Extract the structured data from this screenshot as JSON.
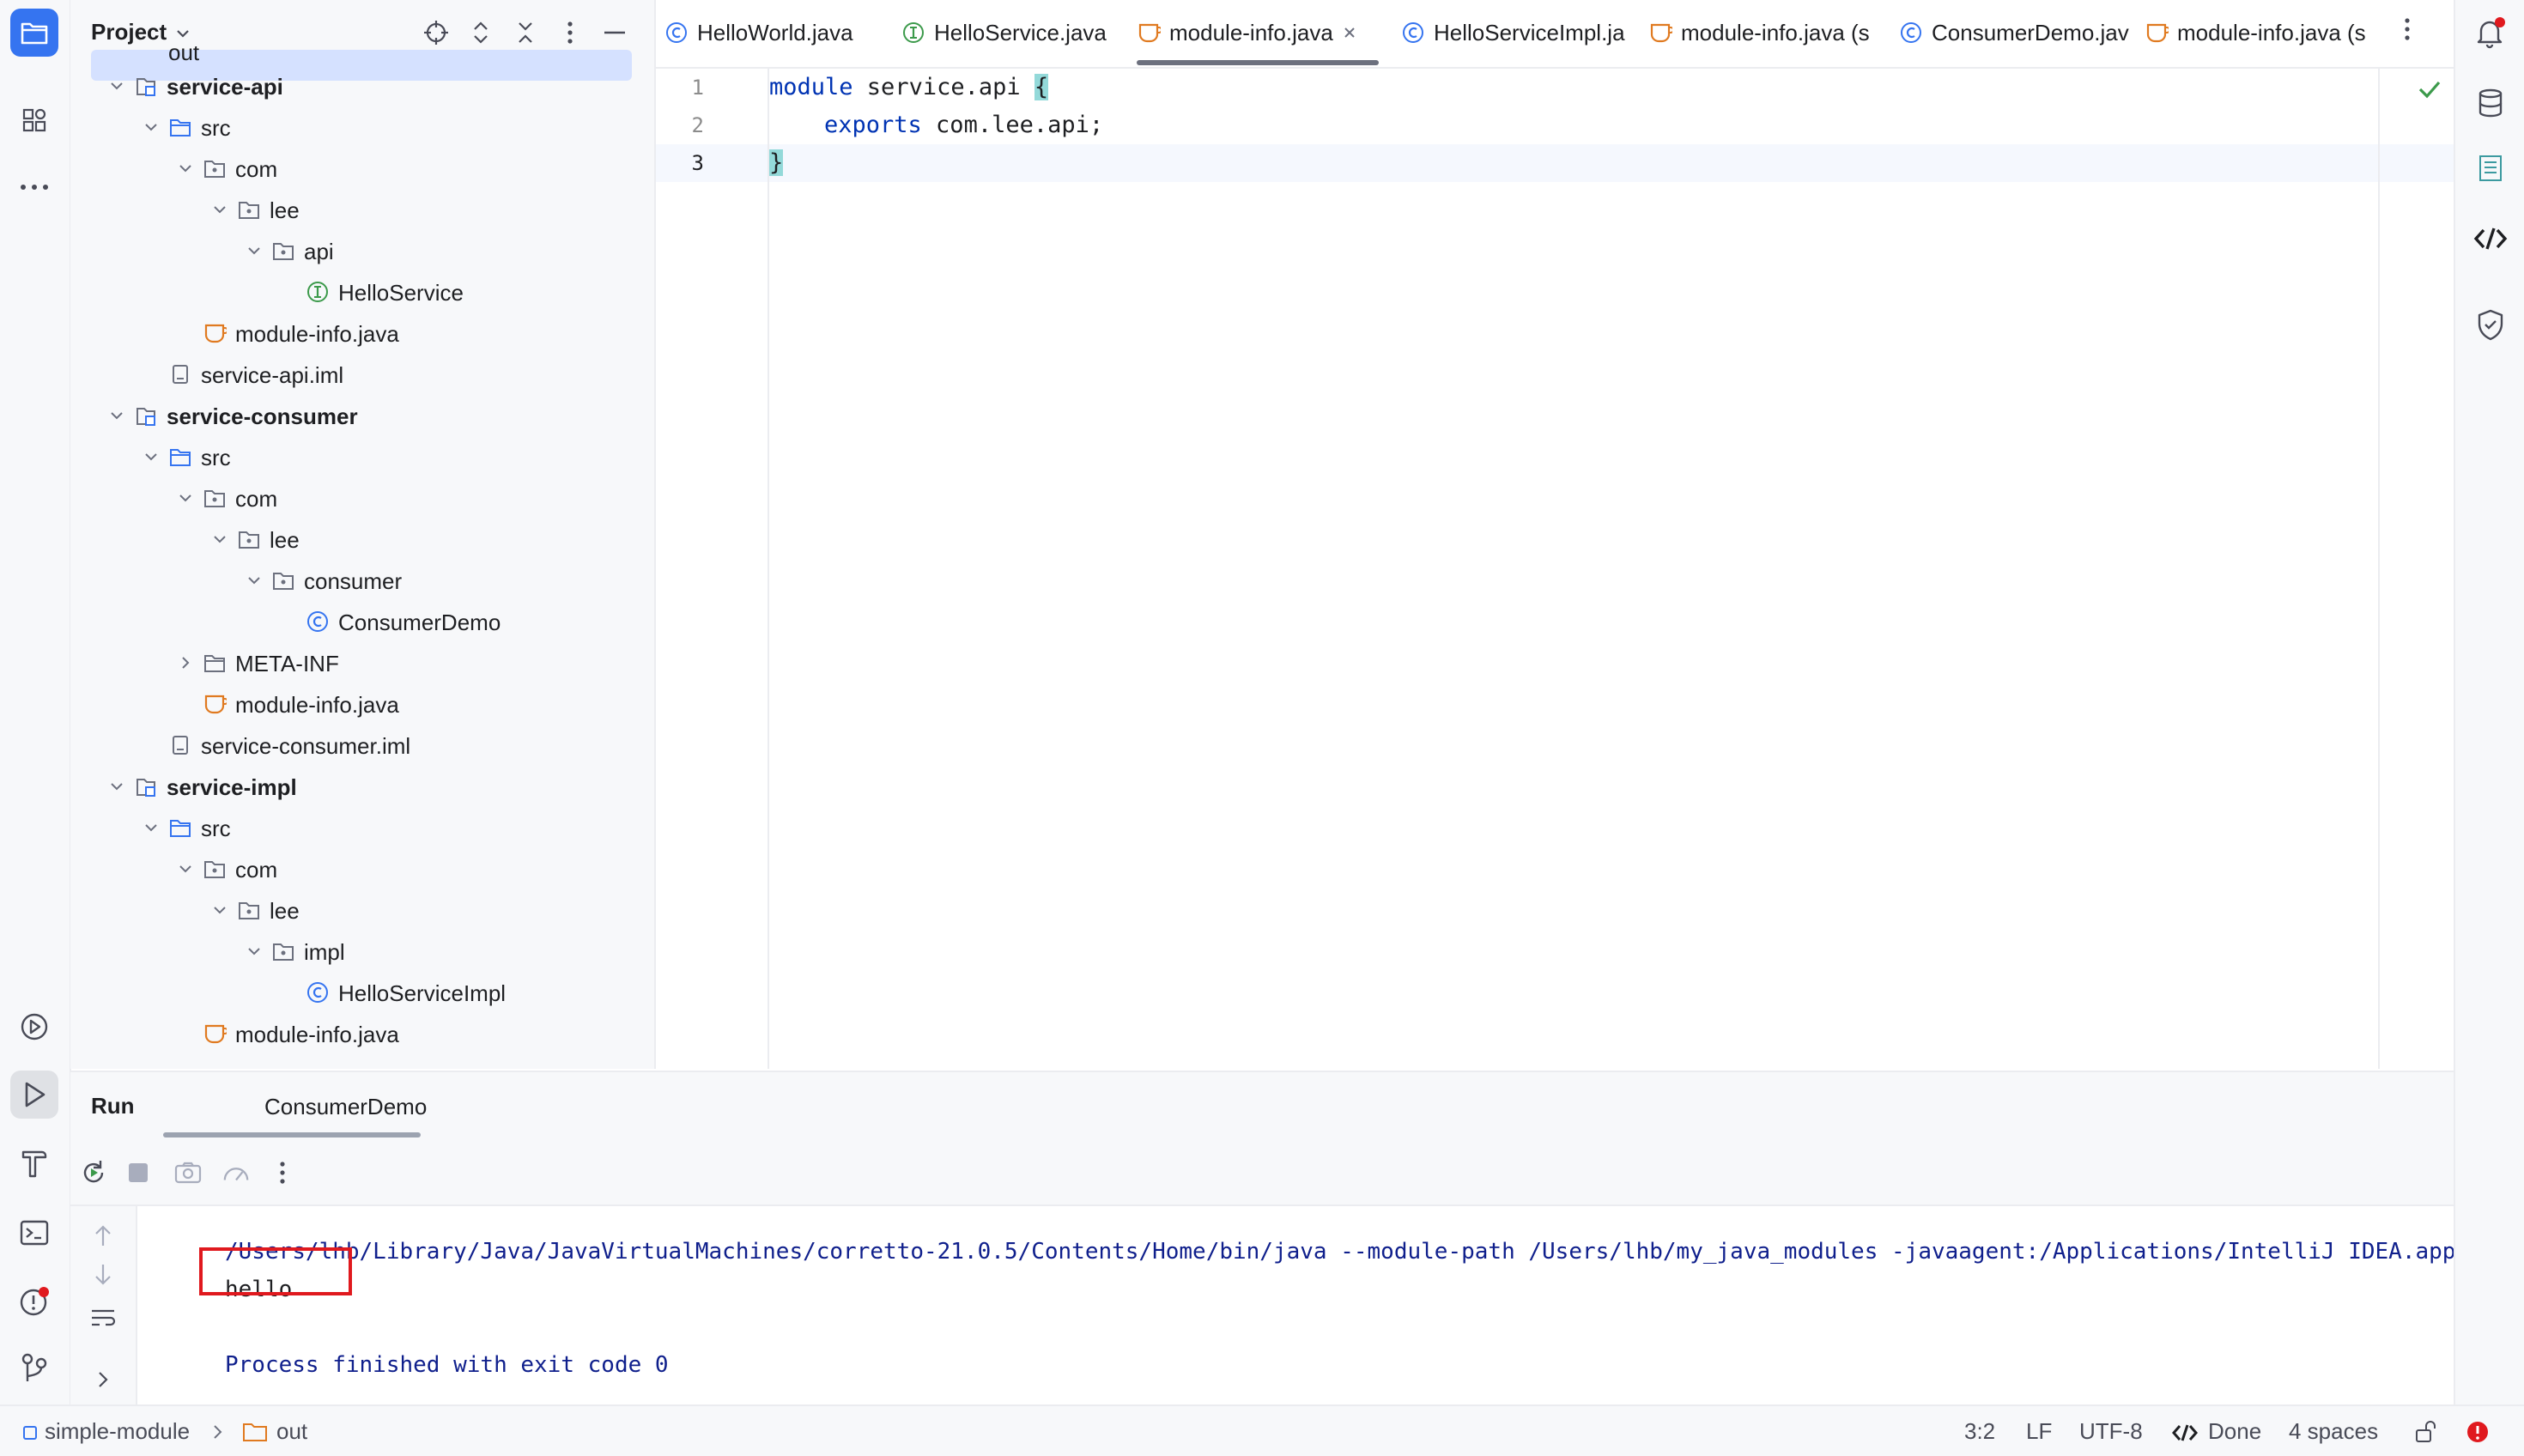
{
  "left_toolbar": {
    "buttons": [
      {
        "icon": "folder-icon",
        "label": "Project"
      },
      {
        "icon": "structure-icon",
        "label": "Structure"
      },
      {
        "icon": "more-icon",
        "label": "More"
      },
      {
        "icon": "services-icon",
        "label": "Services"
      },
      {
        "icon": "run-icon",
        "label": "Run"
      },
      {
        "icon": "build-icon",
        "label": "Build"
      },
      {
        "icon": "terminal-icon",
        "label": "Terminal"
      },
      {
        "icon": "problems-icon",
        "label": "Problems"
      },
      {
        "icon": "git-icon",
        "label": "Git"
      }
    ]
  },
  "right_toolbar": {
    "buttons": [
      {
        "icon": "notifications-icon"
      },
      {
        "icon": "database-icon"
      },
      {
        "icon": "maven-icon"
      },
      {
        "icon": "code-with-me-icon"
      },
      {
        "icon": "security-shield-icon"
      }
    ]
  },
  "project_panel": {
    "title": "Project",
    "partial_top_label": "out",
    "tree": [
      {
        "label": "service-api",
        "type": "module",
        "level": 0,
        "expanded": true,
        "bold": true
      },
      {
        "label": "src",
        "type": "source-folder",
        "level": 1,
        "expanded": true
      },
      {
        "label": "com",
        "type": "package",
        "level": 2,
        "expanded": true
      },
      {
        "label": "lee",
        "type": "package",
        "level": 3,
        "expanded": true
      },
      {
        "label": "api",
        "type": "package",
        "level": 4,
        "expanded": true
      },
      {
        "label": "HelloService",
        "type": "interface",
        "level": 5
      },
      {
        "label": "module-info.java",
        "type": "module-info",
        "level": 2
      },
      {
        "label": "service-api.iml",
        "type": "iml",
        "level": 1
      },
      {
        "label": "service-consumer",
        "type": "module",
        "level": 0,
        "expanded": true,
        "bold": true
      },
      {
        "label": "src",
        "type": "source-folder",
        "level": 1,
        "expanded": true
      },
      {
        "label": "com",
        "type": "package",
        "level": 2,
        "expanded": true
      },
      {
        "label": "lee",
        "type": "package",
        "level": 3,
        "expanded": true
      },
      {
        "label": "consumer",
        "type": "package",
        "level": 4,
        "expanded": true
      },
      {
        "label": "ConsumerDemo",
        "type": "class",
        "level": 5
      },
      {
        "label": "META-INF",
        "type": "folder",
        "level": 2,
        "expanded": false
      },
      {
        "label": "module-info.java",
        "type": "module-info",
        "level": 2
      },
      {
        "label": "service-consumer.iml",
        "type": "iml",
        "level": 1
      },
      {
        "label": "service-impl",
        "type": "module",
        "level": 0,
        "expanded": true,
        "bold": true
      },
      {
        "label": "src",
        "type": "source-folder",
        "level": 1,
        "expanded": true
      },
      {
        "label": "com",
        "type": "package",
        "level": 2,
        "expanded": true
      },
      {
        "label": "lee",
        "type": "package",
        "level": 3,
        "expanded": true
      },
      {
        "label": "impl",
        "type": "package",
        "level": 4,
        "expanded": true
      },
      {
        "label": "HelloServiceImpl",
        "type": "class",
        "level": 5
      },
      {
        "label": "module-info.java",
        "type": "module-info",
        "level": 2
      }
    ]
  },
  "editor": {
    "tabs": [
      {
        "label": "HelloWorld.java",
        "type": "class",
        "active": false
      },
      {
        "label": "HelloService.java",
        "type": "interface",
        "active": false
      },
      {
        "label": "module-info.java",
        "type": "module-info",
        "active": true,
        "closable": true
      },
      {
        "label": "HelloServiceImpl.ja",
        "type": "class",
        "active": false
      },
      {
        "label": "module-info.java (s",
        "type": "module-info",
        "active": false
      },
      {
        "label": "ConsumerDemo.jav",
        "type": "class",
        "active": false
      },
      {
        "label": "module-info.java (s",
        "type": "module-info",
        "active": false
      }
    ],
    "line_numbers": [
      "1",
      "2",
      "3"
    ],
    "code": {
      "line1_keyword": "module",
      "line1_name": " service.api ",
      "line1_brace": "{",
      "line2_keyword": "exports",
      "line2_rest": " com.lee.api;",
      "line3_brace": "}"
    },
    "inspection_status": "ok"
  },
  "run_panel": {
    "title": "Run",
    "tab_label": "ConsumerDemo",
    "console": {
      "command_line": "/Users/lhb/Library/Java/JavaVirtualMachines/corretto-21.0.5/Contents/Home/bin/java --module-path /Users/lhb/my_java_modules -javaagent:/Applications/IntelliJ IDEA.app/Contents/lib/idea_rt.jar",
      "output": "hello",
      "exit_message": "Process finished with exit code 0"
    }
  },
  "status_bar": {
    "project": "simple-module",
    "folder": "out",
    "position": "3:2",
    "line_separator": "LF",
    "encoding": "UTF-8",
    "ai_status": "Done",
    "indent": "4 spaces"
  },
  "colors": {
    "accent": "#3574f0",
    "keyword": "#0033b3",
    "module_info_icon": "#e07a20",
    "class_icon": "#3574f0",
    "interface_icon": "#3c9a4b",
    "error_red": "#e0191e",
    "ok_green": "#3c9a4b"
  }
}
